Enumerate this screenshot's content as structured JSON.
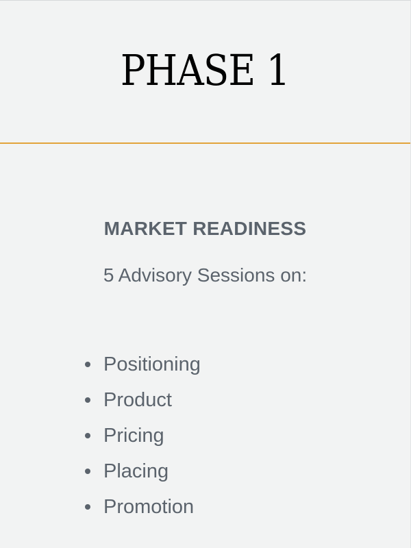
{
  "header": {
    "title": "PHASE 1",
    "accent_color": "#e2a33a"
  },
  "content": {
    "section_title": "MARKET READINESS",
    "sessions_text": "5 Advisory Sessions on:",
    "topics": [
      "Positioning",
      "Product",
      "Pricing",
      "Placing",
      "Promotion"
    ],
    "text_color": "#5b636c"
  }
}
